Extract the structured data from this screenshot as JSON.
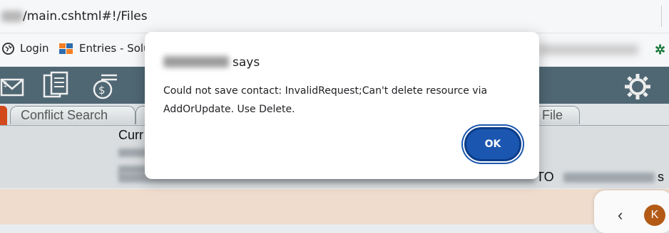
{
  "browser": {
    "url_suffix": "/main.cshtml#!/Files",
    "bookmarks": [
      {
        "label": "Login",
        "icon": "globe-icon"
      },
      {
        "label": "Entries - Solur",
        "icon": "stack-overflow-icon"
      }
    ]
  },
  "app": {
    "toolbar_icons": [
      "email-money-icon",
      "documents-icon",
      "billing-icon",
      "gear-icon"
    ],
    "tabs": [
      {
        "label": "Conflict Search"
      },
      {
        "label": "File"
      }
    ],
    "content": {
      "heading_fragment": "Curr",
      "to_fragment": "TO",
      "end_fragment": "s"
    },
    "avatar_initial": "K"
  },
  "dialog": {
    "title_suffix": "says",
    "message": "Could not save contact: InvalidRequest;Can't delete resource via AddOrUpdate. Use Delete.",
    "ok_label": "OK"
  },
  "colors": {
    "toolbar": "#4f6773",
    "accent_orange": "#d24a1c",
    "ok_button": "#1b57b0"
  }
}
